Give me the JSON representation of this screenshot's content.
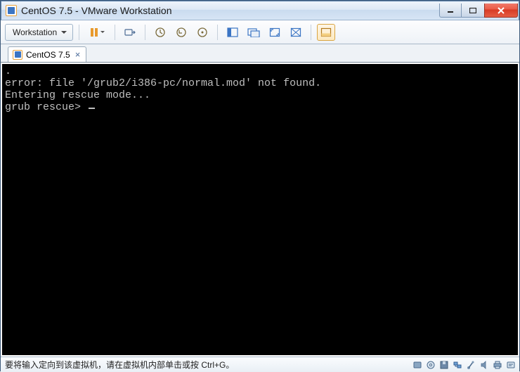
{
  "window": {
    "title": "CentOS 7.5 - VMware Workstation"
  },
  "toolbar": {
    "menu_label": "Workstation"
  },
  "tab": {
    "label": "CentOS 7.5"
  },
  "console": {
    "line1_prefix": ".",
    "line2": "error: file '/grub2/i386-pc/normal.mod' not found.",
    "line3": "Entering rescue mode...",
    "prompt": "grub rescue> "
  },
  "statusbar": {
    "message": "要将输入定向到该虚拟机，请在虚拟机内部单击或按 Ctrl+G。"
  },
  "icons": {
    "pause_color": "#e89a2d",
    "accent": "#3b75c4"
  }
}
